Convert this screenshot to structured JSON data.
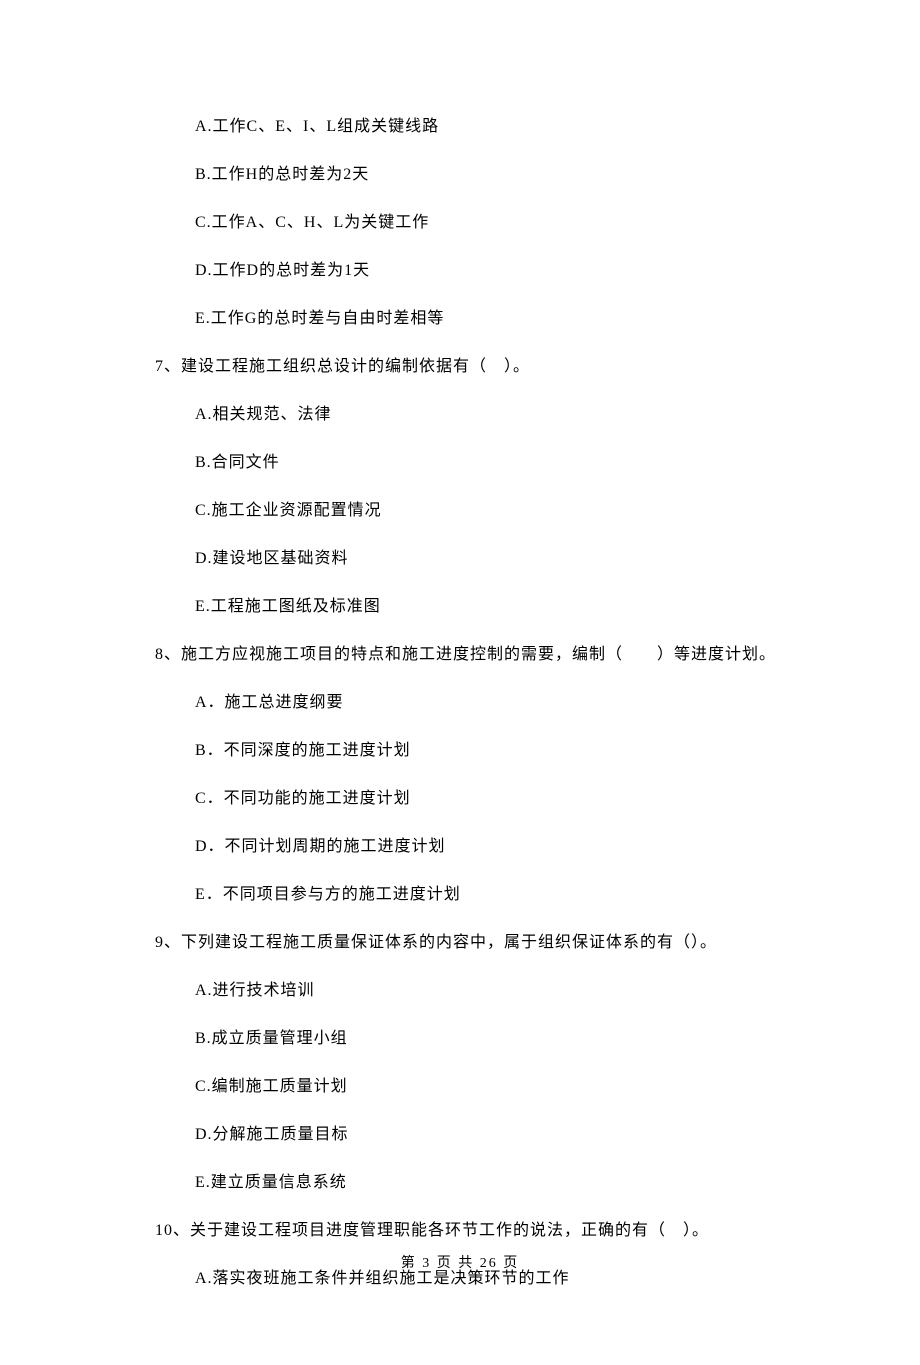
{
  "q6_remainder": {
    "options": [
      "A.工作C、E、I、L组成关键线路",
      "B.工作H的总时差为2天",
      "C.工作A、C、H、L为关键工作",
      "D.工作D的总时差为1天",
      "E.工作G的总时差与自由时差相等"
    ]
  },
  "q7": {
    "stem": "7、建设工程施工组织总设计的编制依据有（　）。",
    "options": [
      "A.相关规范、法律",
      "B.合同文件",
      "C.施工企业资源配置情况",
      "D.建设地区基础资料",
      "E.工程施工图纸及标准图"
    ]
  },
  "q8": {
    "stem": "8、施工方应视施工项目的特点和施工进度控制的需要，编制（　　）等进度计划。",
    "options": [
      "A．施工总进度纲要",
      "B．不同深度的施工进度计划",
      "C．不同功能的施工进度计划",
      "D．不同计划周期的施工进度计划",
      "E．不同项目参与方的施工进度计划"
    ]
  },
  "q9": {
    "stem": "9、下列建设工程施工质量保证体系的内容中，属于组织保证体系的有（）。",
    "options": [
      "A.进行技术培训",
      "B.成立质量管理小组",
      "C.编制施工质量计划",
      "D.分解施工质量目标",
      "E.建立质量信息系统"
    ]
  },
  "q10": {
    "stem": "10、关于建设工程项目进度管理职能各环节工作的说法，正确的有（　）。",
    "options_partial": [
      "A.落实夜班施工条件并组织施工是决策环节的工作"
    ]
  },
  "footer": "第 3 页 共 26 页"
}
